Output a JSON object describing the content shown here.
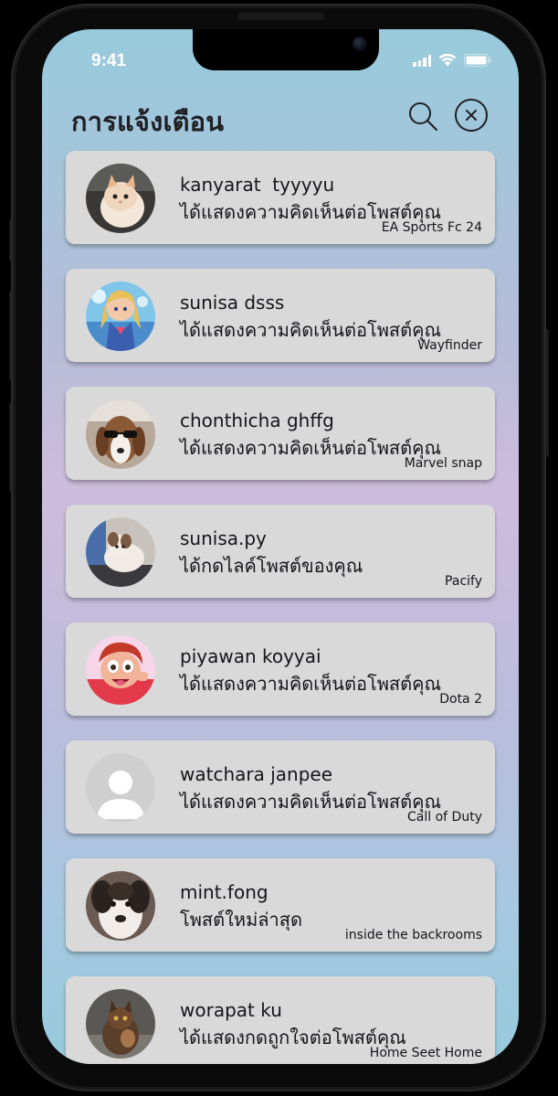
{
  "status_bar": {
    "time": "9:41"
  },
  "header": {
    "title": "การแจ้งเตือน"
  },
  "notifications": [
    {
      "name": "kanyarat  tyyyyu",
      "action": "ได้แสดงความคิดเห็นต่อโพสต์คุณ",
      "game": "EA Sports Fc 24"
    },
    {
      "name": "sunisa dsss",
      "action": "ได้แสดงความคิดเห็นต่อโพสต์คุณ",
      "game": "Wayfinder"
    },
    {
      "name": "chonthicha ghffg",
      "action": "ได้แสดงความคิดเห็นต่อโพสต์คุณ",
      "game": "Marvel snap"
    },
    {
      "name": "sunisa.py",
      "action": "ได้กดไลค์โพสต์ของคุณ",
      "game": "Pacify"
    },
    {
      "name": "piyawan koyyai",
      "action": "ได้แสดงความคิดเห็นต่อโพสต์คุณ",
      "game": "Dota 2"
    },
    {
      "name": "watchara janpee",
      "action": "ได้แสดงความคิดเห็นต่อโพสต์คุณ",
      "game": "Call of Duty"
    },
    {
      "name": "mint.fong",
      "action": "โพสต์ใหม่ล่าสุด",
      "game": "inside the backrooms"
    },
    {
      "name": "worapat ku",
      "action": "ได้แสดงกดถูกใจต่อโพสต์คุณ",
      "game": "Home Seet Home"
    }
  ],
  "icons": {
    "search": "search-icon",
    "close": "close-icon",
    "avatars": [
      "cat-avatar",
      "anime-girl-avatar",
      "dog-sunglasses-avatar",
      "puppy-avatar",
      "cartoon-character-avatar",
      "default-user-avatar",
      "puppy-closeup-avatar",
      "cat-avatar"
    ]
  }
}
